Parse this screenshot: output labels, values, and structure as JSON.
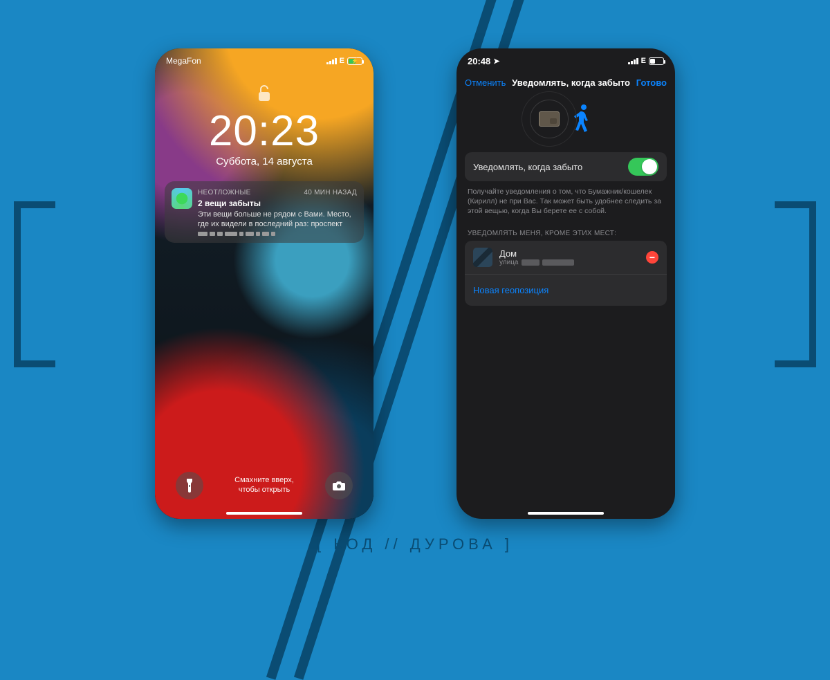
{
  "watermark": "[ КОД // ДУРОВА ]",
  "leftPhone": {
    "carrier": "MegaFon",
    "network": "E",
    "clock": "20:23",
    "date": "Суббота, 14 августа",
    "notification": {
      "category": "НЕОТЛОЖНЫЕ",
      "time": "40 мин назад",
      "title": "2 вещи забыты",
      "body": "Эти вещи больше не рядом с Вами. Место, где их видели в последний раз: проспект"
    },
    "swipeHint1": "Смахните вверх,",
    "swipeHint2": "чтобы открыть"
  },
  "rightPhone": {
    "time": "20:48",
    "network": "E",
    "nav": {
      "cancel": "Отменить",
      "title": "Уведомлять, когда забыто",
      "done": "Готово"
    },
    "toggleLabel": "Уведомлять, когда забыто",
    "explanation": "Получайте уведомления о том, что Бумажник/кошелек (Кирилл) не при Вас. Так может быть удобнее следить за этой вещью, когда Вы берете ее с собой.",
    "listHeader": "УВЕДОМЛЯТЬ МЕНЯ, КРОМЕ ЭТИХ МЕСТ:",
    "home": {
      "title": "Дом",
      "subPrefix": "улица"
    },
    "newLocation": "Новая геопозиция"
  }
}
